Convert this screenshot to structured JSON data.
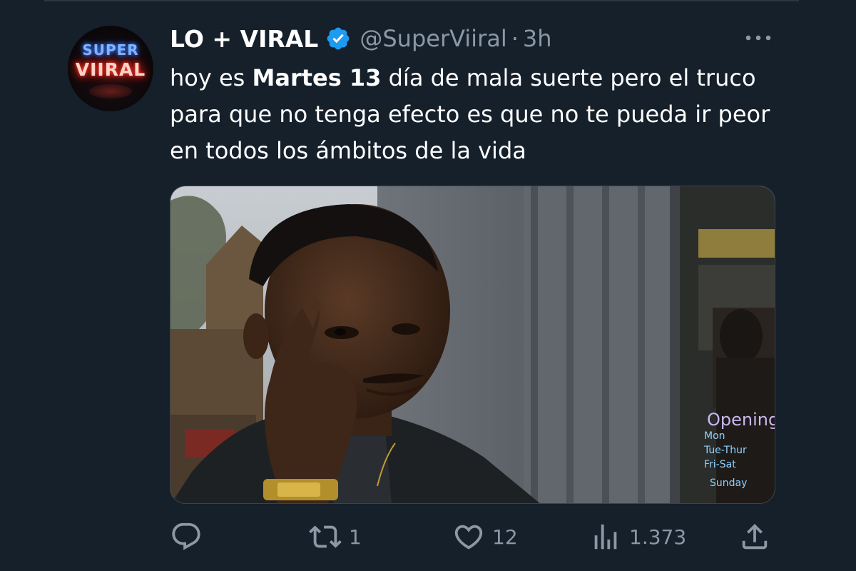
{
  "tweet": {
    "display_name": "LO + VIRAL",
    "handle": "@SuperViiral",
    "separator": "·",
    "time": "3h",
    "text_before": "hoy es ",
    "text_bold": "Martes 13",
    "text_after": " día de mala suerte pero el truco para que no tenga efecto es que no te pueda ir peor en todos los ámbitos de la vida",
    "verified": true,
    "accent_color": "#1d9bf0"
  },
  "avatar": {
    "line1": "SUPER",
    "line2": "VIIRAL"
  },
  "media": {
    "sign_title": "Opening",
    "sign_lines": [
      "Mon",
      "Tue-Thur",
      "Fri-Sat",
      "Sunday"
    ]
  },
  "actions": {
    "reply": {
      "icon": "reply-icon",
      "count": ""
    },
    "retweet": {
      "icon": "retweet-icon",
      "count": "1"
    },
    "like": {
      "icon": "heart-icon",
      "count": "12"
    },
    "views": {
      "icon": "views-icon",
      "count": "1.373"
    },
    "share": {
      "icon": "share-icon",
      "count": ""
    }
  },
  "colors": {
    "background": "#15202b",
    "secondary_text": "#8b98a5",
    "divider": "#2b3640"
  }
}
